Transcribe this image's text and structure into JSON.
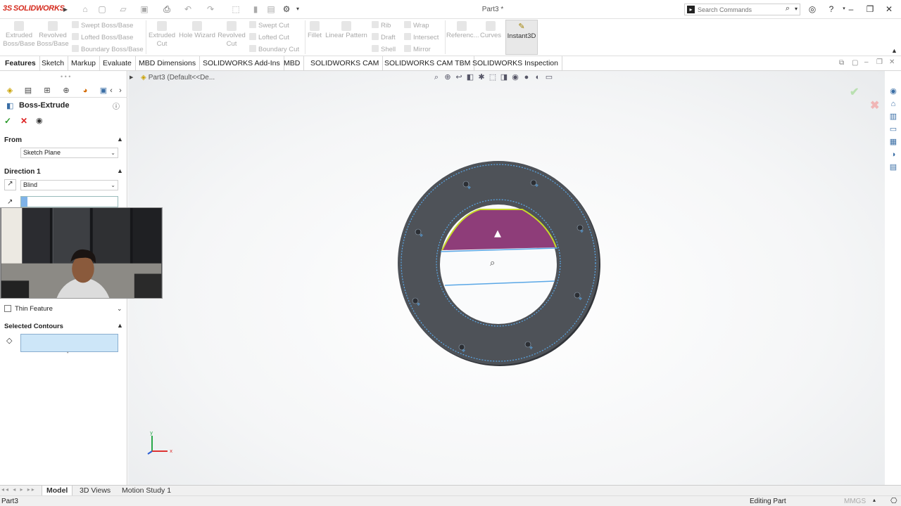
{
  "app": {
    "logo_prefix": "3S",
    "logo_text": "SOLIDWORKS",
    "doc_title": "Part3 *"
  },
  "search": {
    "placeholder": "Search Commands"
  },
  "toolbar": {
    "extruded_boss": "Extruded Boss/Base",
    "revolved_boss": "Revolved Boss/Base",
    "swept_boss": "Swept Boss/Base",
    "lofted_boss": "Lofted Boss/Base",
    "boundary_boss": "Boundary Boss/Base",
    "extruded_cut": "Extruded Cut",
    "hole_wizard": "Hole Wizard",
    "revolved_cut": "Revolved Cut",
    "swept_cut": "Swept Cut",
    "lofted_cut": "Lofted Cut",
    "boundary_cut": "Boundary Cut",
    "fillet": "Fillet",
    "linear_pattern": "Linear Pattern",
    "rib": "Rib",
    "draft": "Draft",
    "shell": "Shell",
    "wrap": "Wrap",
    "intersect": "Intersect",
    "mirror": "Mirror",
    "reference": "Referenc...",
    "curves": "Curves",
    "instant3d": "Instant3D"
  },
  "tabs": [
    "Features",
    "Sketch",
    "Markup",
    "Evaluate",
    "MBD Dimensions",
    "SOLIDWORKS Add-Ins",
    "MBD",
    "SOLIDWORKS CAM",
    "SOLIDWORKS CAM TBM",
    "SOLIDWORKS Inspection"
  ],
  "property_manager": {
    "title": "Boss-Extrude",
    "from": {
      "label": "From",
      "value": "Sketch Plane"
    },
    "direction1": {
      "label": "Direction 1",
      "end_condition": "Blind",
      "depth": ""
    },
    "thin_feature": {
      "label": "Thin Feature",
      "checked": false
    },
    "selected_contours": {
      "label": "Selected Contours"
    }
  },
  "breadcrumb": {
    "text": "Part3  (Default<<De..."
  },
  "model": {
    "face_color": "#4e5258",
    "region_color": "#8e3d79",
    "edge_color": "#5aa7e6",
    "highlight_color": "#c8d82a",
    "triad_labels": {
      "x": "x",
      "y": "y"
    }
  },
  "bottom_tabs": [
    "Model",
    "3D Views",
    "Motion Study 1"
  ],
  "status": {
    "left": "Part3",
    "center": "Editing Part",
    "units": "MMGS"
  }
}
